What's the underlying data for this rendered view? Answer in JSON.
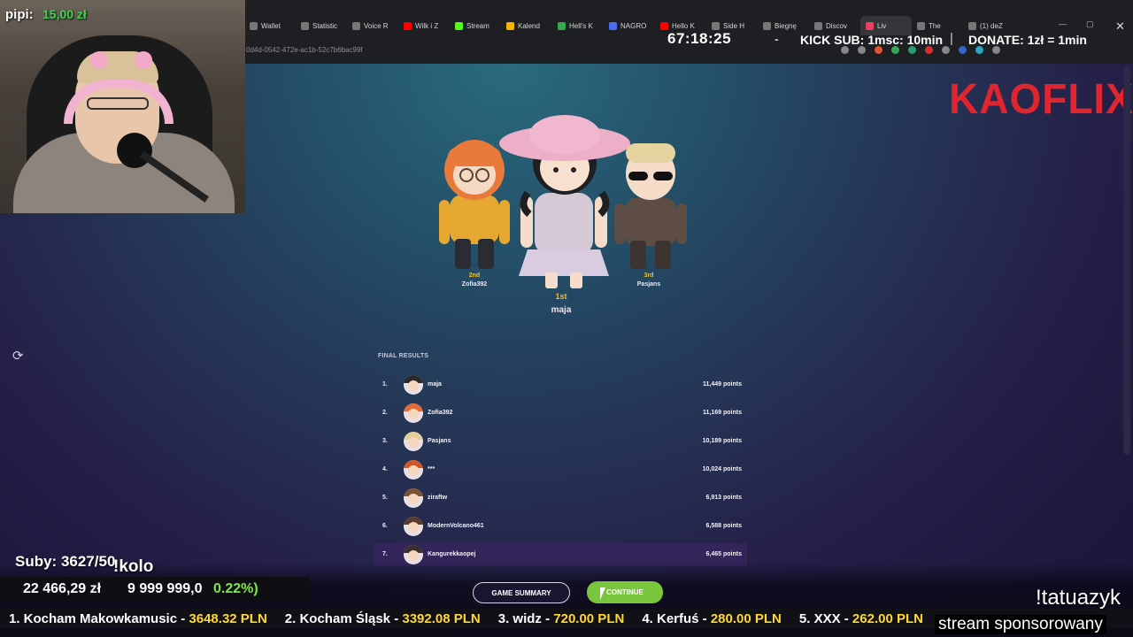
{
  "browser": {
    "tabs": [
      {
        "label": "Wallet",
        "color": "#777"
      },
      {
        "label": "Statistic",
        "color": "#777"
      },
      {
        "label": "Voice R",
        "color": "#777"
      },
      {
        "label": "Wilk i Z",
        "color": "#ff0000"
      },
      {
        "label": "Stream",
        "color": "#53fc18"
      },
      {
        "label": "Kalend",
        "color": "#f5b400"
      },
      {
        "label": "Hell's K",
        "color": "#34a853"
      },
      {
        "label": "NAGRO",
        "color": "#4a6cf7"
      },
      {
        "label": "Hello K",
        "color": "#ff0000"
      },
      {
        "label": "Side H",
        "color": "#777"
      },
      {
        "label": "Biegnę",
        "color": "#777"
      },
      {
        "label": "Discov",
        "color": "#777"
      },
      {
        "label": "Liv",
        "color": "#e94260",
        "active": true
      },
      {
        "label": "The",
        "color": "#777"
      },
      {
        "label": "(1) deZ",
        "color": "#777"
      }
    ],
    "address": "0d4d-0542-472e-ac1b-52c7b6bac99f"
  },
  "overlay": {
    "timer": "67:18:25",
    "timer_sep": "-",
    "kick_sub": "KICK SUB: 1msc: 10min",
    "sep": "|",
    "donate": "DONATE: 1zł = 1min"
  },
  "webcam": {
    "name": "pipi:",
    "value": "15,00 zł"
  },
  "logo": "KAOFLIX",
  "podium": {
    "first": {
      "rank": "1st",
      "name": "maja"
    },
    "second": {
      "rank": "2nd",
      "name": "Zofia392"
    },
    "third": {
      "rank": "3rd",
      "name": "Pasjans"
    }
  },
  "results": {
    "label": "FINAL RESULTS",
    "rows": [
      {
        "pos": "1.",
        "name": "maja",
        "points": "11,449 points",
        "hair": "#2a2a2a"
      },
      {
        "pos": "2.",
        "name": "Zofia392",
        "points": "11,169 points",
        "hair": "#e36b3a"
      },
      {
        "pos": "3.",
        "name": "Pasjans",
        "points": "10,189 points",
        "hair": "#e3cf9c"
      },
      {
        "pos": "4.",
        "name": "***",
        "points": "10,024 points",
        "hair": "#d0562c"
      },
      {
        "pos": "5.",
        "name": "ziraftw",
        "points": "6,913 points",
        "hair": "#7a5334"
      },
      {
        "pos": "6.",
        "name": "ModernVolcano461",
        "points": "6,588 points",
        "hair": "#5a3d2a"
      },
      {
        "pos": "7.",
        "name": "Kangurekkaopej",
        "points": "6,465 points",
        "hair": "#3b2f2a"
      }
    ]
  },
  "buttons": {
    "summary": "GAME SUMMARY",
    "continue": "CONTINUE"
  },
  "stream": {
    "subs": "Suby: 3627/50",
    "kolo": "!kolo",
    "money1": "22 466,29 zł",
    "money2": "9 999 999,0",
    "money_pct": "0.22%)",
    "ticker": [
      {
        "label": "1. Kocham Makowkamusic - ",
        "amount": "3648.32 PLN"
      },
      {
        "label": "2. Kocham Śląsk - ",
        "amount": "3392.08 PLN"
      },
      {
        "label": "3. widz - ",
        "amount": "720.00 PLN"
      },
      {
        "label": "4. Kerfuś - ",
        "amount": "280.00 PLN"
      },
      {
        "label": "5. XXX - ",
        "amount": "262.00 PLN"
      }
    ],
    "tatuaz": "!tatuazyk",
    "sponsor": "stream sponsorowany"
  }
}
